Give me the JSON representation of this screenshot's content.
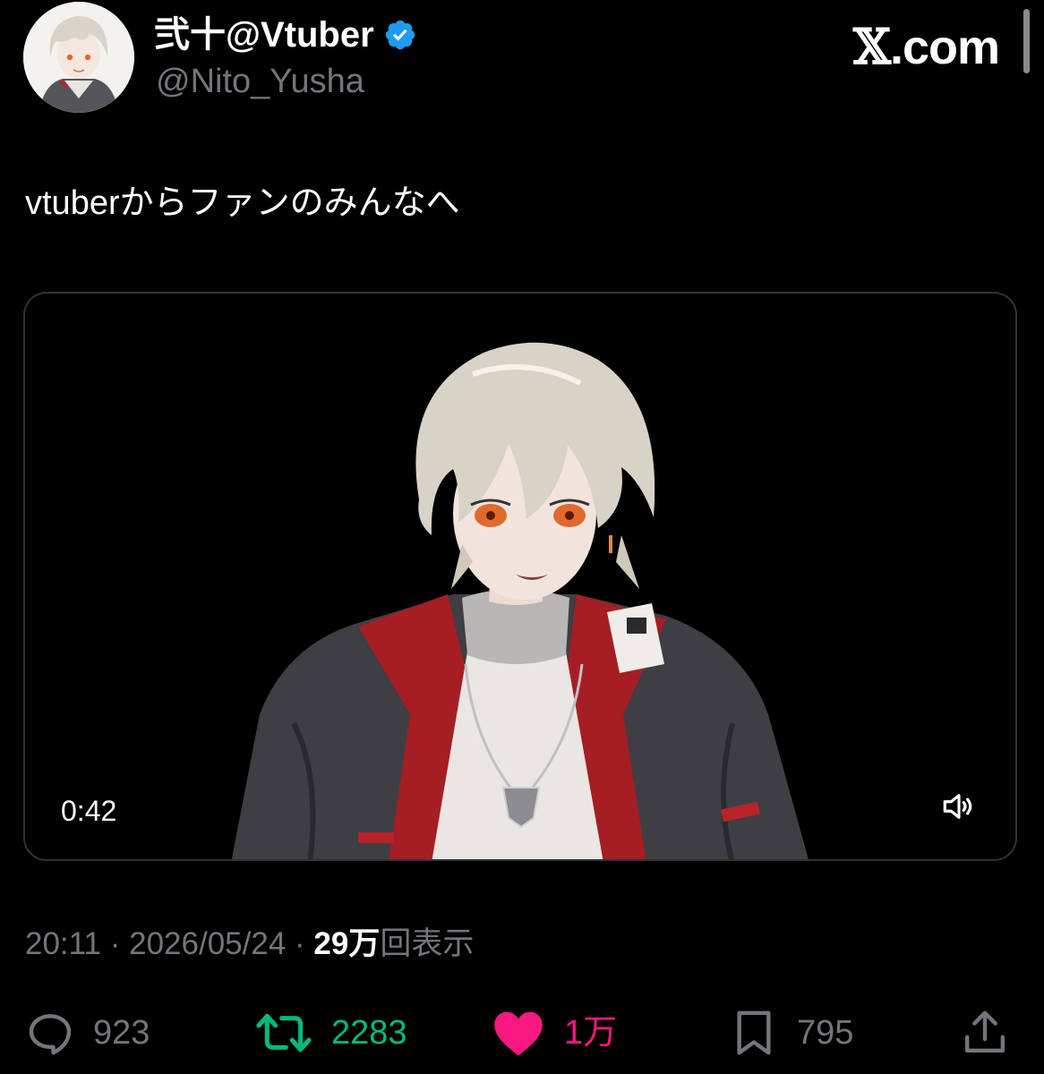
{
  "author": {
    "display_name": "弐十@Vtuber",
    "handle": "@Nito_Yusha",
    "verified": true,
    "verified_color": "#1d9bf0"
  },
  "brand": {
    "logo_x": "𝕏",
    "logo_suffix": ".com"
  },
  "tweet": {
    "text": "vtuberからファンのみんなへ"
  },
  "media": {
    "type": "video",
    "duration": "0:42",
    "mute_icon": "speaker-icon"
  },
  "meta": {
    "time": "20:11",
    "separator1": " · ",
    "date": "2026/05/24",
    "separator2": " · ",
    "views_count": "29万",
    "views_label": "回表示"
  },
  "actions": {
    "replies": "923",
    "retweets": "2283",
    "retweet_color": "#00ba7c",
    "likes": "1万",
    "like_color": "#f91880",
    "bookmarks": "795",
    "icon_color": "#72767b"
  }
}
